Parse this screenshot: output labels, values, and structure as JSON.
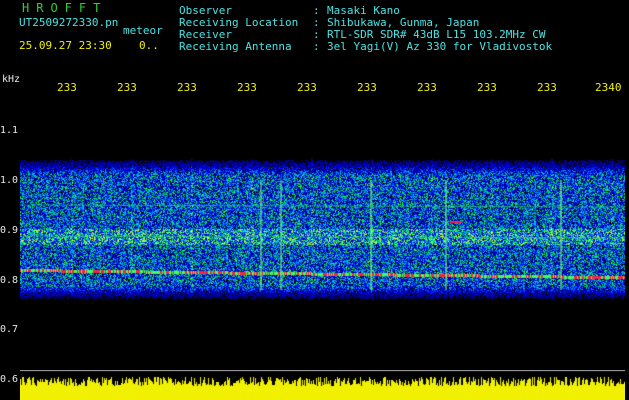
{
  "header": {
    "app_title": "HROFFT",
    "filename": "UT2509272330.pn",
    "tag": "meteor",
    "datetime": "25.09.27 23:30",
    "counter": "0.."
  },
  "info": [
    {
      "label": "Observer",
      "sep": ":",
      "value": "Masaki Kano"
    },
    {
      "label": "Receiving Location",
      "sep": ":",
      "value": "Shibukawa, Gunma, Japan"
    },
    {
      "label": "Receiver",
      "sep": ":",
      "value": "RTL-SDR SDR# 43dB L15 103.2MHz CW"
    },
    {
      "label": "Receiving Antenna",
      "sep": ":",
      "value": "3el Yagi(V) Az 330 for Vladivostok"
    }
  ],
  "y_axis": {
    "unit": "kHz",
    "ticks": [
      "1.1",
      "1.0",
      "0.9",
      "0.8",
      "0.7",
      "0.6"
    ]
  },
  "x_axis": {
    "ticks": [
      "233",
      "233",
      "233",
      "233",
      "233",
      "233",
      "233",
      "233",
      "233",
      "2340"
    ]
  },
  "colors": {
    "background": "#000000",
    "title": "#2dd12d",
    "info": "#49e3e3",
    "axis": "#f0f000",
    "power": "#f0f000",
    "echo": "#ff2040"
  }
}
